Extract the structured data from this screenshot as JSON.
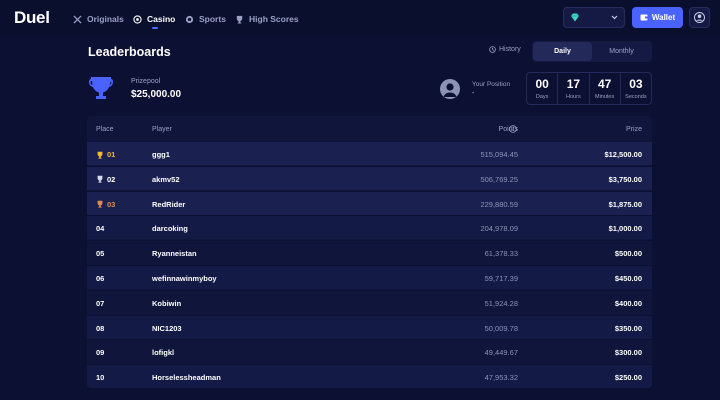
{
  "app": {
    "logo": "Duel",
    "nav": [
      {
        "label": "Originals",
        "icon": "swords-icon",
        "active": false
      },
      {
        "label": "Casino",
        "icon": "casino-chip-icon",
        "active": true
      },
      {
        "label": "Sports",
        "icon": "ball-icon",
        "active": false
      },
      {
        "label": "High Scores",
        "icon": "trophy-icon",
        "active": false
      }
    ],
    "wallet_label": "Wallet"
  },
  "header": {
    "title": "Leaderboards",
    "history_label": "History",
    "tabs": [
      {
        "label": "Daily",
        "active": true
      },
      {
        "label": "Monthly",
        "active": false
      }
    ]
  },
  "prize": {
    "label": "Prizepool",
    "value": "$25,000.00"
  },
  "position": {
    "label": "Your Position",
    "value": "-"
  },
  "timer": [
    {
      "value": "00",
      "unit": "Days"
    },
    {
      "value": "17",
      "unit": "Hours"
    },
    {
      "value": "47",
      "unit": "Minutes"
    },
    {
      "value": "03",
      "unit": "Seconds"
    }
  ],
  "table": {
    "headers": {
      "place": "Place",
      "player": "Player",
      "points": "Points",
      "prize": "Prize"
    },
    "rows": [
      {
        "place": "01",
        "player": "ggg1",
        "points": "515,094.45",
        "prize": "$12,500.00",
        "trophy": "gold"
      },
      {
        "place": "02",
        "player": "akmv52",
        "points": "506,769.25",
        "prize": "$3,750.00",
        "trophy": "silver"
      },
      {
        "place": "03",
        "player": "RedRider",
        "points": "229,880.59",
        "prize": "$1,875.00",
        "trophy": "bronze"
      },
      {
        "place": "04",
        "player": "darcoking",
        "points": "204,978.09",
        "prize": "$1,000.00"
      },
      {
        "place": "05",
        "player": "Ryanneistan",
        "points": "61,378.33",
        "prize": "$500.00"
      },
      {
        "place": "06",
        "player": "wefinnawinmyboy",
        "points": "59,717.39",
        "prize": "$450.00"
      },
      {
        "place": "07",
        "player": "Kobiwin",
        "points": "51,924.28",
        "prize": "$400.00"
      },
      {
        "place": "08",
        "player": "NIC1203",
        "points": "50,009.78",
        "prize": "$350.00"
      },
      {
        "place": "09",
        "player": "lofigkl",
        "points": "49,449.67",
        "prize": "$300.00"
      },
      {
        "place": "10",
        "player": "Horselessheadman",
        "points": "47,953.32",
        "prize": "$250.00"
      }
    ]
  },
  "colors": {
    "background": "#0c1033",
    "accent": "#4a62ff",
    "gold": "#f5b82e",
    "silver": "#d7dbec",
    "bronze": "#e08a4f"
  }
}
